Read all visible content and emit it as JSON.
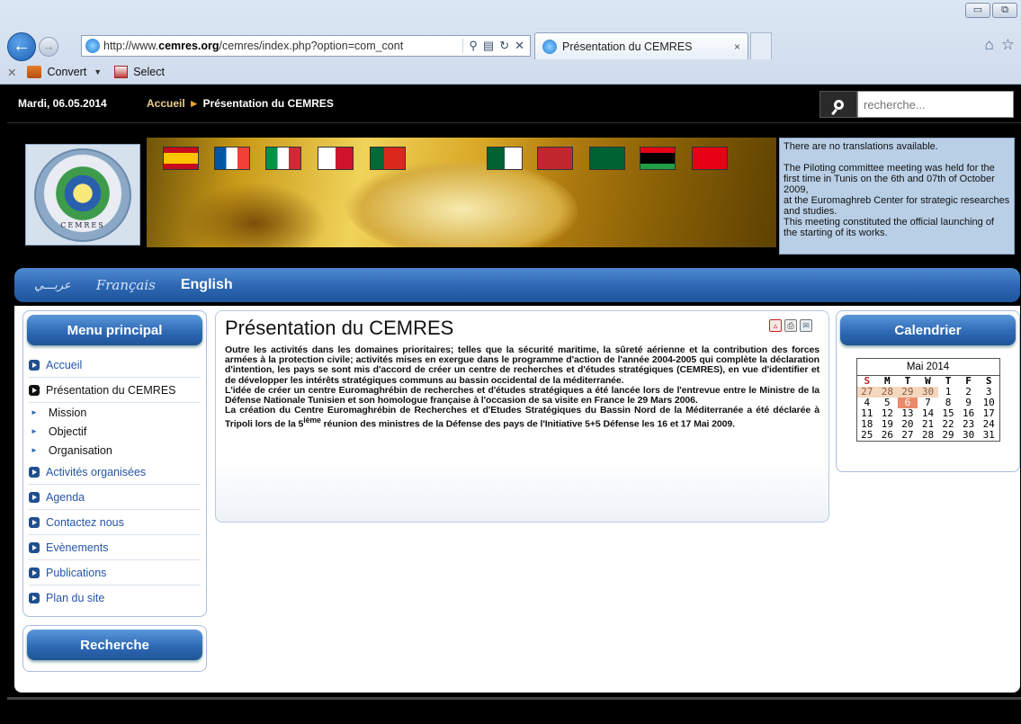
{
  "browser": {
    "window_buttons": [
      "▭",
      "⧉"
    ],
    "url_prefix": "http://www.",
    "url_domain": "cemres.org",
    "url_rest": "/cemres/index.php?option=com_cont",
    "tab_title": "Présentation du CEMRES",
    "tab_close": "×",
    "command_bar": {
      "convert": "Convert",
      "select": "Select"
    },
    "icons": [
      "back-arrow-icon",
      "forward-arrow-icon",
      "search-icon",
      "compatibility-icon",
      "refresh-icon",
      "stop-icon",
      "home-icon",
      "favorites-star-icon"
    ]
  },
  "topbar": {
    "date": "Mardi, 06.05.2014",
    "breadcrumb_home": "Accueil",
    "breadcrumb_current": "Présentation du CEMRES",
    "search_placeholder": "recherche..."
  },
  "logo_text": "CEMRES",
  "flags": [
    "Spain",
    "France",
    "Italy",
    "Malta",
    "Portugal",
    "Algeria",
    "Morocco",
    "Mauritania",
    "Libya",
    "Tunisia"
  ],
  "news": {
    "line1": "There are no translations available.",
    "line2": "The Piloting committee meeting was held for the first time in Tunis on the 6th and 07th of October 2009,",
    "line3": "at the Euromaghreb Center for strategic researches and studies.",
    "line4": "This meeting constituted the official launching of the starting of its works."
  },
  "languages": {
    "arabic": "عربـــي",
    "french": "Français",
    "english": "English"
  },
  "menu": {
    "title": "Menu principal",
    "items": [
      {
        "label": "Accueil"
      },
      {
        "label": "Présentation du CEMRES"
      },
      {
        "label": "Activités organisées"
      },
      {
        "label": "Agenda"
      },
      {
        "label": "Contactez nous"
      },
      {
        "label": "Evènements"
      },
      {
        "label": "Publications"
      },
      {
        "label": "Plan du site"
      }
    ],
    "subitems": [
      {
        "label": "Mission"
      },
      {
        "label": "Objectif"
      },
      {
        "label": "Organisation"
      }
    ]
  },
  "search_panel": {
    "title": "Recherche"
  },
  "article": {
    "title": "Présentation du CEMRES",
    "p1": "Outre les activités dans les domaines prioritaires; telles que la sécurité maritime, la sûreté aérienne et la contribution des forces armées à la protection civile; activités mises en exergue dans le programme d'action de l'année 2004-2005 qui complète la déclaration d'intention, les pays se sont mis d'accord de créer un centre de recherches et d'études stratégiques (CEMRES), en vue d'identifier et de développer les intérêts stratégiques communs au bassin occidental de la méditerranée.",
    "p2": " L'idée de créer un centre Euromaghrébin de recherches et d'études stratégiques a été lancée lors de l'entrevue entre le Ministre de la Défense Nationale Tunisien  et son homologue française à l'occasion de sa visite en France  le 29 Mars 2006.",
    "p3_a": "La création du Centre Euromaghrébin de Recherches et d'Etudes Stratégiques du Bassin Nord de la Méditerranée a été déclarée à Tripoli lors de la 5",
    "p3_sup": "ième",
    "p3_b": " réunion des ministres de la Défense des pays de  l'Initiative 5+5 Défense les 16 et 17 Mai 2009."
  },
  "calendar": {
    "title": "Calendrier",
    "month": "Mai 2014",
    "weekdays": [
      "S",
      "M",
      "T",
      "W",
      "T",
      "F",
      "S"
    ],
    "weeks": [
      [
        "27",
        "28",
        "29",
        "30",
        "1",
        "2",
        "3"
      ],
      [
        "4",
        "5",
        "6",
        "7",
        "8",
        "9",
        "10"
      ],
      [
        "11",
        "12",
        "13",
        "14",
        "15",
        "16",
        "17"
      ],
      [
        "18",
        "19",
        "20",
        "21",
        "22",
        "23",
        "24"
      ],
      [
        "25",
        "26",
        "27",
        "28",
        "29",
        "30",
        "31"
      ]
    ],
    "today": "6"
  },
  "colors": {
    "accent_blue": "#2f6ab5",
    "link_blue": "#2456a8",
    "banner_gold": "#d9a725",
    "news_bg": "#b9cfe6"
  }
}
